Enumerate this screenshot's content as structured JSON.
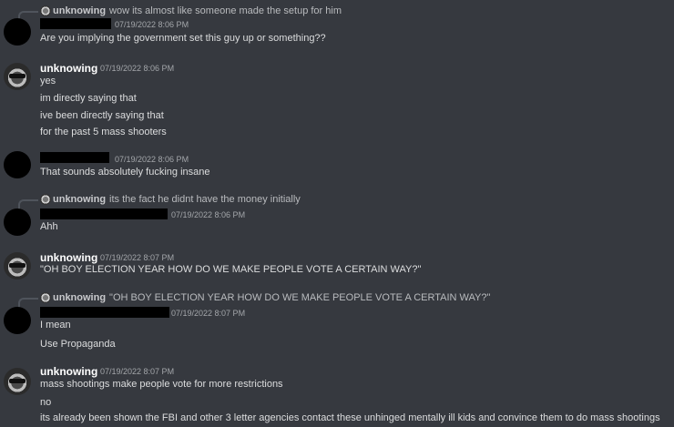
{
  "messages": [
    {
      "reply": {
        "author": "unknowing",
        "text": "wow its almost like someone made the setup for him"
      },
      "timestamp": "07/19/2022 8:06 PM",
      "lines": [
        "Are you implying the government set this guy up or something??"
      ]
    },
    {
      "author": "unknowing",
      "timestamp": "07/19/2022 8:06 PM",
      "lines": [
        "yes",
        "im directly saying that",
        "ive  been directly saying that",
        "for the past 5 mass shooters"
      ]
    },
    {
      "timestamp": "07/19/2022 8:06 PM",
      "lines": [
        "That sounds absolutely fucking insane"
      ]
    },
    {
      "reply": {
        "author": "unknowing",
        "text": "its the fact he didnt have the money initially"
      },
      "timestamp": "07/19/2022 8:06 PM",
      "lines": [
        "Ahh"
      ]
    },
    {
      "author": "unknowing",
      "timestamp": "07/19/2022 8:07 PM",
      "lines": [
        "\"OH BOY ELECTION YEAR HOW DO WE MAKE PEOPLE VOTE A CERTAIN WAY?\""
      ]
    },
    {
      "reply": {
        "author": "unknowing",
        "text": "\"OH BOY ELECTION YEAR HOW DO WE MAKE PEOPLE VOTE A CERTAIN WAY?\""
      },
      "timestamp": "07/19/2022 8:07 PM",
      "lines": [
        "I mean",
        "Use Propaganda"
      ]
    },
    {
      "author": "unknowing",
      "timestamp": "07/19/2022 8:07 PM",
      "lines": [
        "mass shootings make people vote for more restrictions",
        "no",
        "its already been shown the FBI and other 3 letter agencies contact these unhinged mentally ill kids and convince them to do mass shootings"
      ]
    }
  ]
}
